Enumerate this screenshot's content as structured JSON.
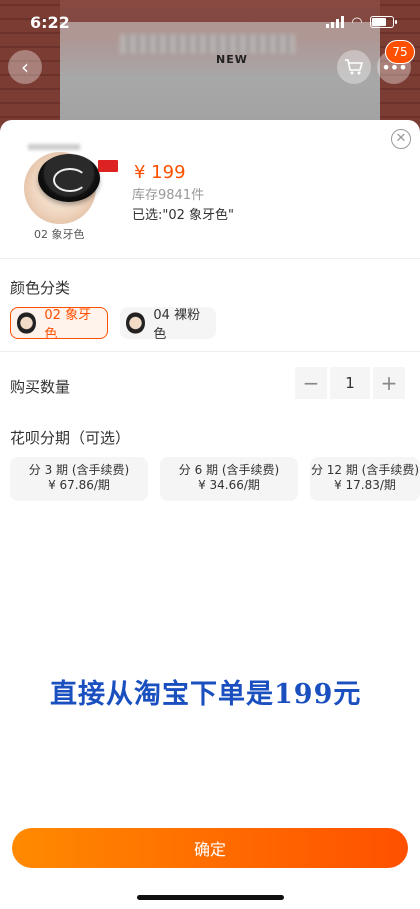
{
  "status_bar": {
    "time": "6:22"
  },
  "background_page": {
    "label": "NEW",
    "cart_badge": "75"
  },
  "sku": {
    "image_caption": "02 象牙色",
    "price": "¥ 199",
    "stock": "库存9841件",
    "selected": "已选:\"02 象牙色\""
  },
  "color_section": {
    "title": "颜色分类",
    "options": [
      {
        "label": "02 象牙色"
      },
      {
        "label": "04 裸粉色"
      }
    ]
  },
  "quantity_section": {
    "title": "购买数量",
    "value": "1",
    "minus": "−",
    "plus": "+"
  },
  "installment_section": {
    "title": "花呗分期（可选）",
    "plans": [
      {
        "line1": "分 3 期 (含手续费)",
        "line2": "¥ 67.86/期"
      },
      {
        "line1": "分 6 期 (含手续费)",
        "line2": "¥ 34.66/期"
      },
      {
        "line1": "分 12 期 (含手续费)",
        "line2": "¥ 17.83/期"
      }
    ]
  },
  "promo_text": "直接从淘宝下单是199元",
  "confirm_label": "确定",
  "colors": {
    "accent": "#ff5000",
    "confirm_start": "#ff8a00",
    "promo": "#1a4fbf"
  }
}
